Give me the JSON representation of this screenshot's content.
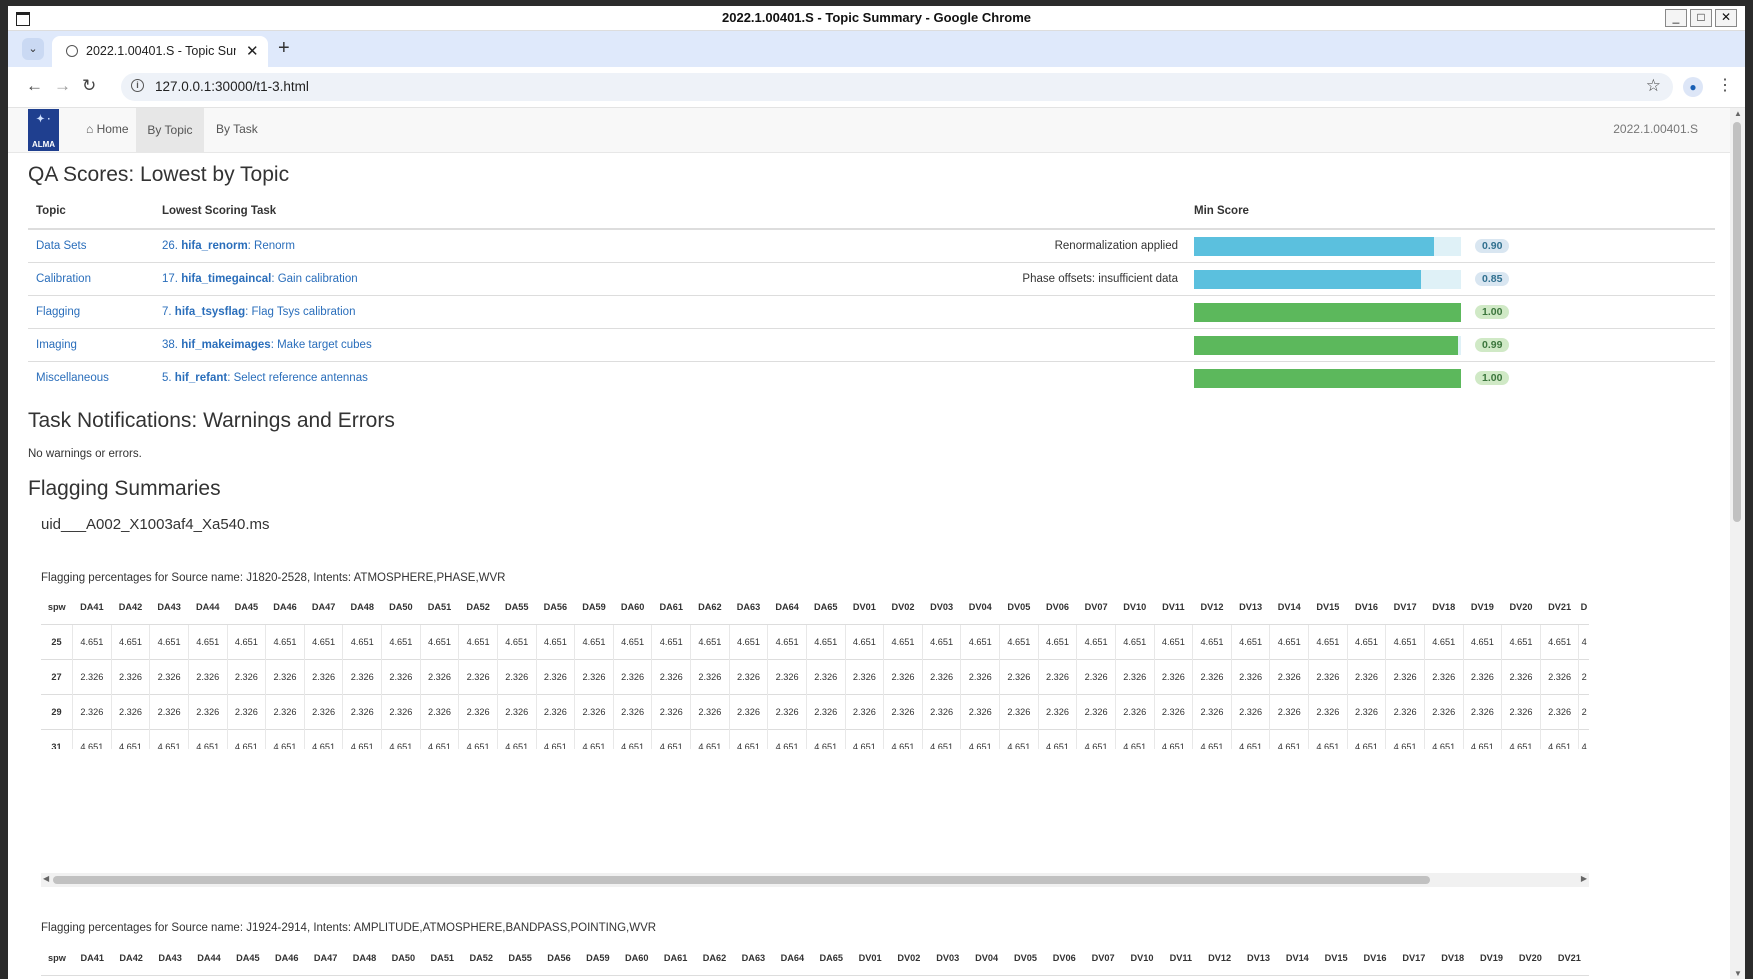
{
  "window": {
    "title": "2022.1.00401.S - Topic Summary - Google Chrome"
  },
  "browser": {
    "tab_title": "2022.1.00401.S - Topic Summary",
    "url": "127.0.0.1:30000/t1-3.html"
  },
  "navbar": {
    "logo_text": "ALMA",
    "home": "Home",
    "by_topic": "By Topic",
    "by_task": "By Task",
    "project_id": "2022.1.00401.S"
  },
  "qa": {
    "heading": "QA Scores: Lowest by Topic",
    "headers": [
      "Topic",
      "Lowest Scoring Task",
      "",
      "Min Score"
    ],
    "rows": [
      {
        "topic": "Data Sets",
        "num": "26.",
        "task": "hifa_renorm",
        "desc": ": Renorm",
        "note": "Renormalization applied",
        "score": "0.90",
        "value": 0.9,
        "color": "#5bc0de",
        "badge": "b"
      },
      {
        "topic": "Calibration",
        "num": "17.",
        "task": "hifa_timegaincal",
        "desc": ": Gain calibration",
        "note": "Phase offsets: insufficient data",
        "score": "0.85",
        "value": 0.85,
        "color": "#5bc0de",
        "badge": "b"
      },
      {
        "topic": "Flagging",
        "num": "7.",
        "task": "hifa_tsysflag",
        "desc": ": Flag Tsys calibration",
        "note": "",
        "score": "1.00",
        "value": 1.0,
        "color": "#5cb85c",
        "badge": "g"
      },
      {
        "topic": "Imaging",
        "num": "38.",
        "task": "hif_makeimages",
        "desc": ": Make target cubes",
        "note": "",
        "score": "0.99",
        "value": 0.99,
        "color": "#5cb85c",
        "badge": "g"
      },
      {
        "topic": "Miscellaneous",
        "num": "5.",
        "task": "hif_refant",
        "desc": ": Select reference antennas",
        "note": "",
        "score": "1.00",
        "value": 1.0,
        "color": "#5cb85c",
        "badge": "g"
      }
    ]
  },
  "notifications": {
    "heading": "Task Notifications: Warnings and Errors",
    "text": "No warnings or errors."
  },
  "flagging": {
    "heading": "Flagging Summaries",
    "ms_name": "uid___A002_X1003af4_Xa540.ms",
    "tables": [
      {
        "caption": "Flagging percentages for Source name: J1820-2528, Intents: ATMOSPHERE,PHASE,WVR",
        "columns": [
          "spw",
          "DA41",
          "DA42",
          "DA43",
          "DA44",
          "DA45",
          "DA46",
          "DA47",
          "DA48",
          "DA50",
          "DA51",
          "DA52",
          "DA55",
          "DA56",
          "DA59",
          "DA60",
          "DA61",
          "DA62",
          "DA63",
          "DA64",
          "DA65",
          "DV01",
          "DV02",
          "DV03",
          "DV04",
          "DV05",
          "DV06",
          "DV07",
          "DV10",
          "DV11",
          "DV12",
          "DV13",
          "DV14",
          "DV15",
          "DV16",
          "DV17",
          "DV18",
          "DV19",
          "DV20",
          "DV21",
          "D"
        ],
        "rows": [
          {
            "spw": "25",
            "value": "4.651",
            "last": "4"
          },
          {
            "spw": "27",
            "value": "2.326",
            "last": "2"
          },
          {
            "spw": "29",
            "value": "2.326",
            "last": "2"
          },
          {
            "spw": "31",
            "value": "4.651",
            "last": "4"
          }
        ]
      },
      {
        "caption": "Flagging percentages for Source name: J1924-2914, Intents: AMPLITUDE,ATMOSPHERE,BANDPASS,POINTING,WVR",
        "columns": [
          "spw",
          "DA41",
          "DA42",
          "DA43",
          "DA44",
          "DA45",
          "DA46",
          "DA47",
          "DA48",
          "DA50",
          "DA51",
          "DA52",
          "DA55",
          "DA56",
          "DA59",
          "DA60",
          "DA61",
          "DA62",
          "DA63",
          "DA64",
          "DA65",
          "DV01",
          "DV02",
          "DV03",
          "DV04",
          "DV05",
          "DV06",
          "DV07",
          "DV10",
          "DV11",
          "DV12",
          "DV13",
          "DV14",
          "DV15",
          "DV16",
          "DV17",
          "DV18",
          "DV19",
          "DV20",
          "DV21"
        ],
        "rows": []
      }
    ]
  },
  "icons": [
    "window-icon",
    "tab-list-icon",
    "globe-icon",
    "close-icon",
    "plus-icon",
    "back-icon",
    "forward-icon",
    "reload-icon",
    "info-icon",
    "star-icon",
    "profile-icon",
    "menu-icon",
    "home-icon"
  ]
}
